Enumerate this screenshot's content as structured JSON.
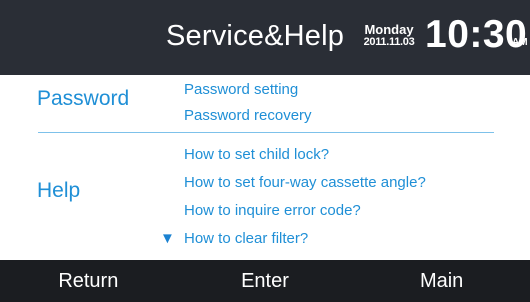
{
  "header": {
    "title": "Service&Help",
    "day": "Monday",
    "date": "2011.11.03",
    "time": "10:30",
    "ampm": "AM"
  },
  "password_section": {
    "label": "Password",
    "items": [
      "Password setting",
      "Password recovery"
    ]
  },
  "help_section": {
    "label": "Help",
    "items": [
      "How to set child lock?",
      "How to set four-way cassette angle?",
      "How to inquire error code?",
      "How to clear filter?"
    ],
    "scroll_icon": "triangle-down-icon",
    "scroll_glyph": "▼"
  },
  "footer": {
    "return_label": "Return",
    "enter_label": "Enter",
    "main_label": "Main"
  },
  "colors": {
    "header_bg": "#2a2e36",
    "footer_bg": "#1b1d21",
    "accent": "#1f8fd6",
    "divider": "#7dc1ea"
  }
}
